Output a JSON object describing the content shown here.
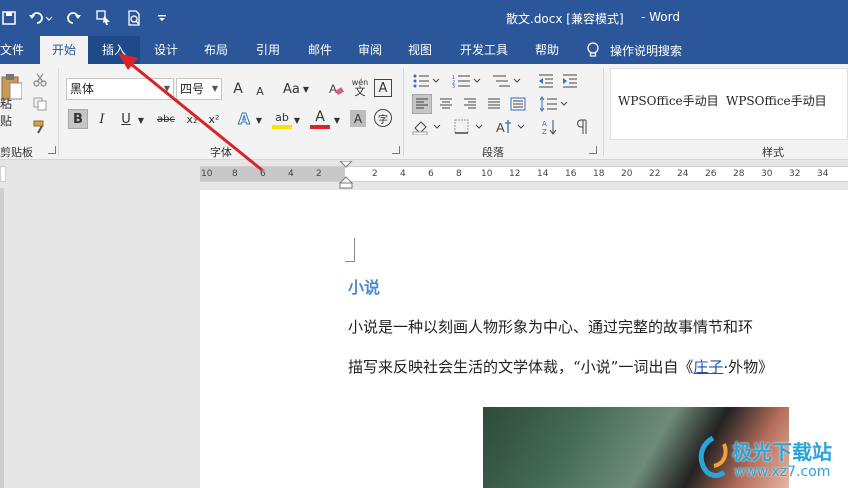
{
  "window": {
    "title": "散文.docx [兼容模式]",
    "app_name": "- Word"
  },
  "quick_access": {
    "save_icon": "save-icon",
    "undo_icon": "undo-icon",
    "redo_icon": "redo-icon",
    "select_icon": "select-objects-icon",
    "print_preview_icon": "print-preview-icon",
    "customize_icon": "customize-icon"
  },
  "tabs": [
    {
      "label": "文件"
    },
    {
      "label": "开始"
    },
    {
      "label": "插入"
    },
    {
      "label": "设计"
    },
    {
      "label": "布局"
    },
    {
      "label": "引用"
    },
    {
      "label": "邮件"
    },
    {
      "label": "审阅"
    },
    {
      "label": "视图"
    },
    {
      "label": "开发工具"
    },
    {
      "label": "帮助"
    }
  ],
  "tell_me": "操作说明搜索",
  "ribbon": {
    "clipboard": {
      "paste_label": "粘贴",
      "group_label": "剪贴板"
    },
    "font": {
      "font_name": "黑体",
      "font_size": "四号",
      "case_label": "Aa",
      "bold": "B",
      "italic": "I",
      "underline": "U",
      "strike": "abc",
      "subscript": "x₂",
      "superscript": "x²",
      "text_effect": "A",
      "highlight": "ab",
      "font_color": "A",
      "char_shading": "A",
      "enclose": "字",
      "phonetic": "wén",
      "char_border": "A",
      "grow": "A",
      "shrink": "A",
      "group_label": "字体"
    },
    "paragraph": {
      "group_label": "段落"
    },
    "styles": {
      "items": [
        "WPSOffice手动目",
        "WPSOffice手动目"
      ],
      "group_label": "样式"
    }
  },
  "ruler": {
    "ticks": [
      "10",
      "8",
      "6",
      "4",
      "2",
      "2",
      "4",
      "6",
      "8",
      "10",
      "12",
      "14",
      "16",
      "18",
      "20",
      "22",
      "24",
      "26",
      "28",
      "30",
      "32",
      "34"
    ]
  },
  "document": {
    "heading": "小说",
    "para1": "小说是一种以刻画人物形象为中心、通过完整的故事情节和环",
    "para2_before": "描写来反映社会生活的文学体裁，“小说”一词出自《",
    "para2_link": "庄子",
    "para2_after": "·外物》"
  },
  "watermark": {
    "text": "极光下载站",
    "url": "www.xz7.com"
  },
  "colors": {
    "titlebar": "#2b579a",
    "heading": "#4c8bc8",
    "arrow": "#d8232a",
    "watermark": "#2aa5d9"
  }
}
